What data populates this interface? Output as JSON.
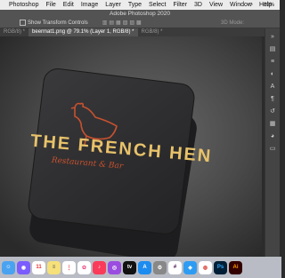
{
  "menubar": {
    "items": [
      "Photoshop",
      "File",
      "Edit",
      "Image",
      "Layer",
      "Type",
      "Select",
      "Filter",
      "3D",
      "View",
      "Window",
      "Help"
    ],
    "battery": "83%"
  },
  "window": {
    "title": "Adobe Photoshop 2020"
  },
  "options": {
    "show_transform_controls": "Show Transform Controls",
    "mode_3d": "3D Mode:"
  },
  "tabs": [
    {
      "label": "RGB/8) *"
    },
    {
      "label": "beermat1.png @ 79.1% (Layer 1, RGB/8) *"
    },
    {
      "label": "RGB/8) *"
    }
  ],
  "artwork": {
    "logo_text": "THE FRENCH HEN",
    "subtitle_text": "Restaurant & Bar"
  },
  "panel_icons": [
    "collapse-arrows-icon",
    "layers-icon",
    "properties-icon",
    "adjustments-icon",
    "character-icon",
    "paragraph-icon",
    "history-icon",
    "swatches-icon",
    "color-icon",
    "gradients-icon"
  ],
  "dock_apps": [
    "Finder",
    "Siri",
    "Calendar",
    "Notes",
    "Reminders",
    "Photos",
    "Music",
    "Podcasts",
    "Apple TV",
    "App Store",
    "System Preferences",
    "Slack",
    "Safari",
    "Chrome",
    "Photoshop",
    "Illustrator"
  ]
}
